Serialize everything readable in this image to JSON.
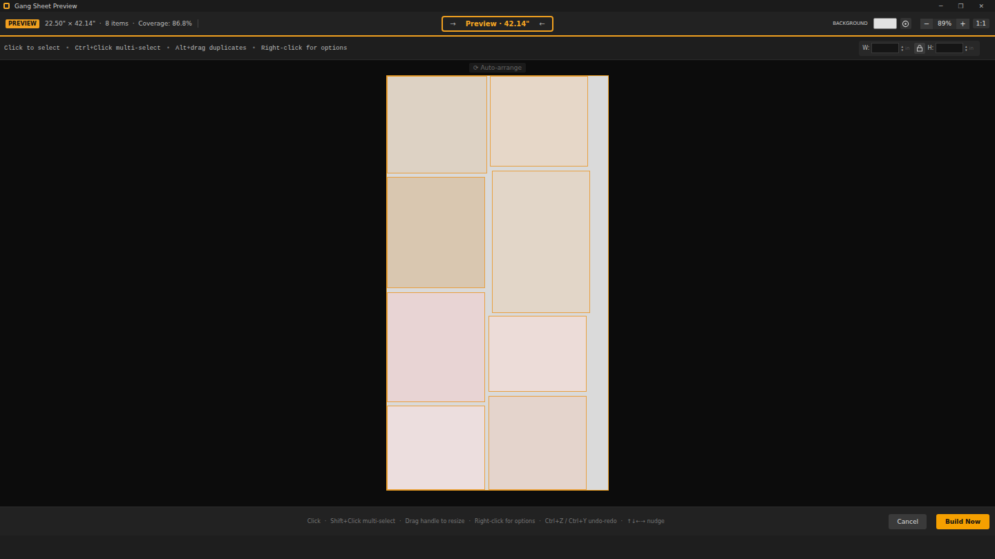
{
  "window": {
    "title": "Gang Sheet Preview",
    "controls": [
      "─",
      "❐",
      "✕"
    ]
  },
  "toolbar": {
    "badge": "PREVIEW",
    "meta": "22.50\" × 42.14\"  ·  8 items  ·  Coverage: 86.8%",
    "preview_nav": {
      "prev": "→",
      "label": "Preview · 42.14\"",
      "next": "←"
    },
    "background": {
      "label": "BACKGROUND",
      "color": "#e2e2e2"
    },
    "zoom": {
      "minus": "−",
      "value": "89%",
      "plus": "+",
      "fit": "1:1"
    }
  },
  "hints": {
    "items": [
      "Click to select",
      "Ctrl+Click multi-select",
      "Alt+drag duplicates",
      "Right-click for options"
    ],
    "separator": "•"
  },
  "dimensions": {
    "w_label": "W:",
    "w_value": "",
    "h_label": "H:",
    "h_value": "",
    "unit": "in",
    "locked": false
  },
  "auto_arrange": "⟳ Auto-arrange",
  "sheet": {
    "items": [
      {
        "color": "#ddd2c4"
      },
      {
        "color": "#e6d7c8"
      },
      {
        "color": "#d9c7b0"
      },
      {
        "color": "#e2d6c8"
      },
      {
        "color": "#e8d4d4"
      },
      {
        "color": "#ecdcd8"
      },
      {
        "color": "#ecdede"
      },
      {
        "color": "#e4d4cc"
      }
    ]
  },
  "footer": {
    "hints": [
      "Click",
      "Shift+Click multi-select",
      "Drag handle to resize",
      "Right-click for options",
      "Ctrl+Z / Ctrl+Y undo-redo",
      "↑↓←→ nudge"
    ],
    "separator": "·",
    "buttons": [
      {
        "label": "Cancel",
        "primary": false
      },
      {
        "label": "Build Now",
        "primary": true
      }
    ]
  }
}
